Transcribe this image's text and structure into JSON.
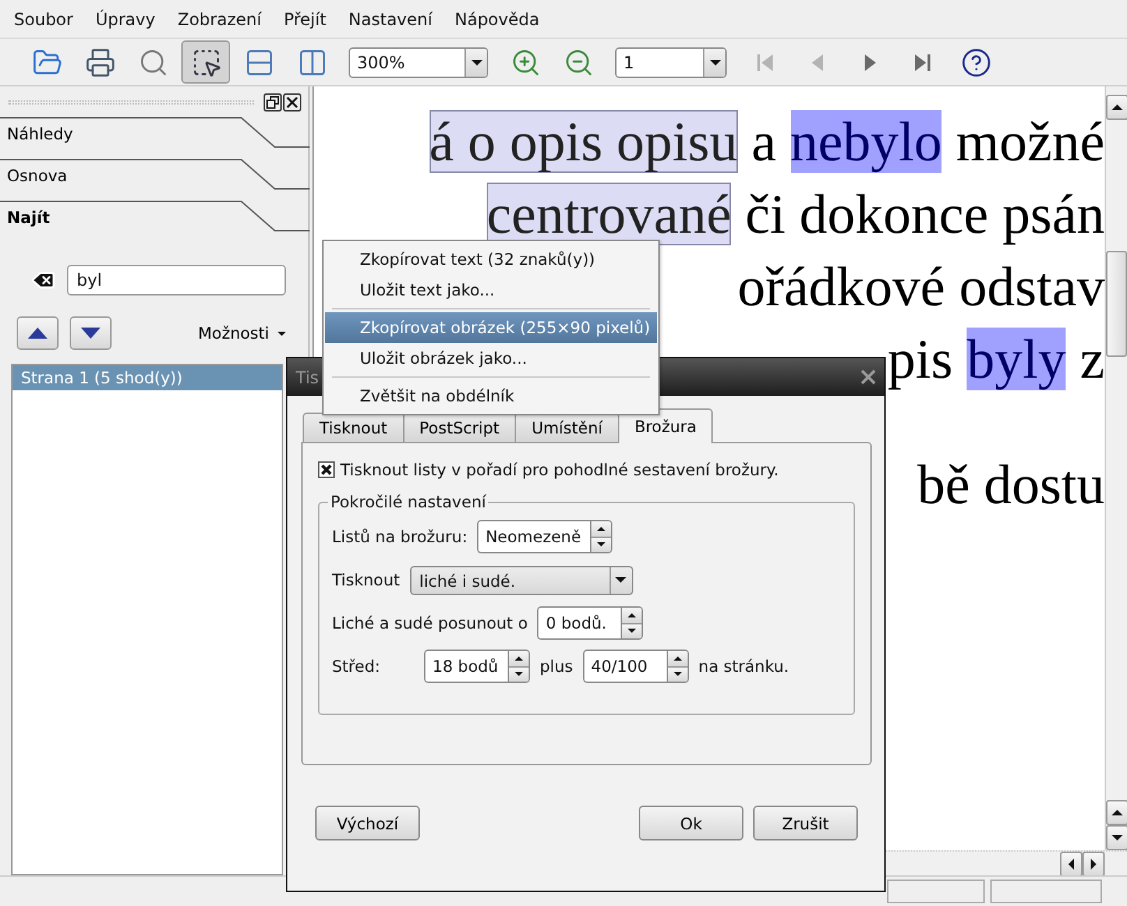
{
  "menu_bar": [
    "Soubor",
    "Úpravy",
    "Zobrazení",
    "Přejít",
    "Nastavení",
    "Nápověda"
  ],
  "toolbar": {
    "tools": [
      {
        "kind": "open",
        "selected": false
      },
      {
        "kind": "print",
        "selected": false
      },
      {
        "kind": "zoom-tool",
        "selected": false
      },
      {
        "kind": "select-tool",
        "selected": true
      },
      {
        "kind": "fit-width",
        "selected": false
      },
      {
        "kind": "two-pages",
        "selected": false
      }
    ],
    "zoom": "300%",
    "zoom_buttons": [
      {
        "kind": "zoom-in"
      },
      {
        "kind": "zoom-out"
      }
    ],
    "page": "1",
    "navigation": [
      {
        "kind": "first",
        "disabled": true
      },
      {
        "kind": "previous",
        "disabled": true
      },
      {
        "kind": "next",
        "disabled": false
      },
      {
        "kind": "last",
        "disabled": false
      }
    ],
    "help": {
      "kind": "whats-this"
    }
  },
  "sidebar": {
    "tabs": [
      {
        "label": "Náhledy",
        "selected": false
      },
      {
        "label": "Osnova",
        "selected": false
      },
      {
        "label": "Najít",
        "selected": true
      }
    ],
    "search": {
      "value": "byl"
    },
    "options": "Možnosti",
    "results": [
      {
        "label": "Strana 1 (5 shod(y))",
        "selected": true
      }
    ]
  },
  "document": {
    "lines": [
      {
        "space_before": false,
        "segments": [
          {
            "text": "á o opis opisu",
            "selected": true,
            "match": false
          },
          {
            "text": " a ",
            "selected": false,
            "match": false
          },
          {
            "text": "nebylo",
            "selected": false,
            "match": true
          },
          {
            "text": " možné",
            "selected": false,
            "match": false
          }
        ]
      },
      {
        "space_before": false,
        "segments": [
          {
            "text": "centrované",
            "selected": true,
            "match": false
          },
          {
            "text": " či dokonce psán",
            "selected": false,
            "match": false
          }
        ]
      },
      {
        "space_before": false,
        "segments": [
          {
            "text": "ořádkové odstav",
            "selected": false,
            "match": false
          }
        ]
      },
      {
        "space_before": false,
        "segments": [
          {
            "text": "pis ",
            "selected": false,
            "match": false
          },
          {
            "text": "byly",
            "selected": false,
            "match": true
          },
          {
            "text": " z",
            "selected": false,
            "match": false
          }
        ]
      },
      {
        "space_before": true,
        "segments": [
          {
            "text": "bě dostu",
            "selected": false,
            "match": false
          }
        ]
      }
    ]
  },
  "context_menu": {
    "items": [
      {
        "kind": "item",
        "label": "Zkopírovat text (32 znaků(y))",
        "selected": false
      },
      {
        "kind": "item",
        "label": "Uložit text jako...",
        "selected": false
      },
      {
        "kind": "separator"
      },
      {
        "kind": "item",
        "label": "Zkopírovat obrázek (255×90 pixelů)",
        "selected": true
      },
      {
        "kind": "item",
        "label": "Uložit obrázek jako...",
        "selected": false
      },
      {
        "kind": "separator"
      },
      {
        "kind": "item",
        "label": "Zvětšit na obdélník",
        "selected": false
      }
    ]
  },
  "dialog": {
    "title": "Tis",
    "tabs": [
      {
        "label": "Tisknout",
        "selected": false
      },
      {
        "label": "PostScript",
        "selected": false
      },
      {
        "label": "Umístění",
        "selected": false
      },
      {
        "label": "Brožura",
        "selected": true
      }
    ],
    "checkbox": {
      "label": "Tisknout listy v pořadí pro pohodlné sestavení brožury.",
      "checked": true
    },
    "group": {
      "title": "Pokročilé nastavení",
      "rows": [
        {
          "items": [
            {
              "kind": "label",
              "text": "Listů na brožuru:"
            },
            {
              "kind": "spin",
              "value": "Neomezeně"
            }
          ]
        },
        {
          "items": [
            {
              "kind": "label",
              "text": "Tisknout"
            },
            {
              "kind": "combo",
              "value": "liché i sudé."
            }
          ]
        },
        {
          "items": [
            {
              "kind": "label",
              "text": "Liché a sudé posunout o"
            },
            {
              "kind": "spin",
              "value": "0 bodů."
            }
          ]
        },
        {
          "items": [
            {
              "kind": "label",
              "text": "Střed:"
            },
            {
              "kind": "spin",
              "value": "18 bodů"
            },
            {
              "kind": "label",
              "text": "plus"
            },
            {
              "kind": "spin",
              "value": "40/100"
            },
            {
              "kind": "label",
              "text": "na stránku."
            }
          ]
        }
      ]
    },
    "buttons": [
      "Výchozí",
      "Ok",
      "Zrušit"
    ]
  }
}
